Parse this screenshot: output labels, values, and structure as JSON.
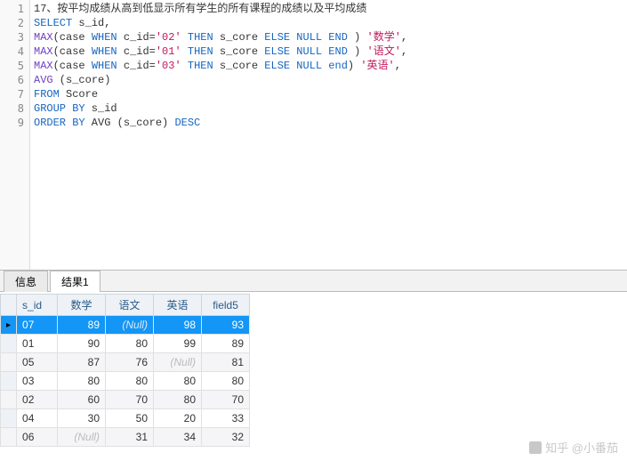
{
  "editor": {
    "lines": [
      "1",
      "2",
      "3",
      "4",
      "5",
      "6",
      "7",
      "8",
      "9"
    ]
  },
  "sql": {
    "l1_prefix": "17、按平均成绩从高到低显示所有学生的所有课程的成绩以及平均成绩",
    "l2_select": "SELECT",
    "l2_rest": " s_id,",
    "l3_max": "MAX",
    "l3_a": "(case ",
    "l3_when": "WHEN",
    "l3_b": " c_id=",
    "l3_s1": "'02'",
    "l3_then": " THEN",
    "l3_c": " s_core ",
    "l3_else": "ELSE NULL END",
    "l3_d": " ) ",
    "l3_s2": "'数学'",
    "l3_e": ",",
    "l4_max": "MAX",
    "l4_a": "(case ",
    "l4_when": "WHEN",
    "l4_b": " c_id=",
    "l4_s1": "'01'",
    "l4_then": " THEN",
    "l4_c": " s_core ",
    "l4_else": "ELSE NULL END",
    "l4_d": " ) ",
    "l4_s2": "'语文'",
    "l4_e": ",",
    "l5_max": "MAX",
    "l5_a": "(case ",
    "l5_when": "WHEN",
    "l5_b": " c_id=",
    "l5_s1": "'03'",
    "l5_then": " THEN",
    "l5_c": " s_core ",
    "l5_else": "ELSE NULL end",
    "l5_d": ") ",
    "l5_s2": "'英语'",
    "l5_e": ",",
    "l6_avg": "AVG",
    "l6_rest": " (s_core)",
    "l7_from": "FROM",
    "l7_rest": " Score",
    "l8_group": "GROUP BY",
    "l8_rest": " s_id",
    "l9_order": "ORDER BY",
    "l9_mid": " AVG (s_core) ",
    "l9_desc": "DESC"
  },
  "tabs": {
    "t0": "信息",
    "t1": "结果1"
  },
  "grid": {
    "headers": {
      "c0": "s_id",
      "c1": "数学",
      "c2": "语文",
      "c3": "英语",
      "c4": "field5"
    },
    "nullLabel": "(Null)",
    "r0": {
      "c0": "07",
      "c1": "89",
      "c2": "(Null)",
      "c3": "98",
      "c4": "93"
    },
    "r1": {
      "c0": "01",
      "c1": "90",
      "c2": "80",
      "c3": "99",
      "c4": "89"
    },
    "r2": {
      "c0": "05",
      "c1": "87",
      "c2": "76",
      "c3": "(Null)",
      "c4": "81"
    },
    "r3": {
      "c0": "03",
      "c1": "80",
      "c2": "80",
      "c3": "80",
      "c4": "80"
    },
    "r4": {
      "c0": "02",
      "c1": "60",
      "c2": "70",
      "c3": "80",
      "c4": "70"
    },
    "r5": {
      "c0": "04",
      "c1": "30",
      "c2": "50",
      "c3": "20",
      "c4": "33"
    },
    "r6": {
      "c0": "06",
      "c1": "(Null)",
      "c2": "31",
      "c3": "34",
      "c4": "32"
    }
  },
  "watermark": {
    "text": "知乎 @小番茄"
  }
}
